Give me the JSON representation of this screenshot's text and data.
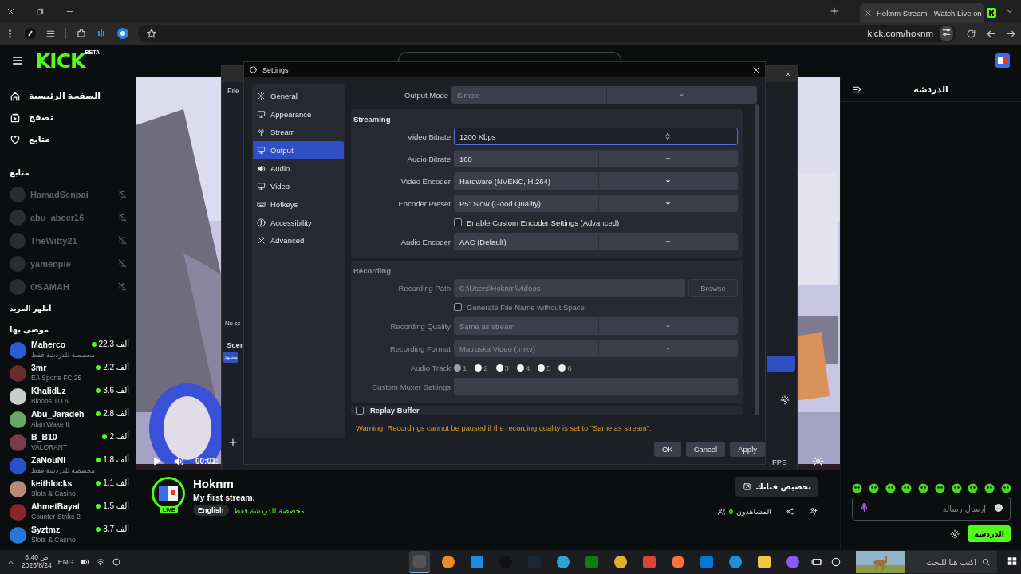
{
  "browser": {
    "tab_title": "Hoknm Stream - Watch Live on",
    "url": "kick.com/hoknm"
  },
  "header": {
    "logo": "KICK",
    "logo_badge": "BETA"
  },
  "sidebar": {
    "nav": [
      {
        "label": "الصفحة الرئيسية"
      },
      {
        "label": "تصفح"
      },
      {
        "label": "متابع"
      }
    ],
    "following_title": "متابع",
    "following": [
      {
        "name": "HamadSenpai",
        "live": false
      },
      {
        "name": "abu_abeer16",
        "live": false
      },
      {
        "name": "TheWitty21",
        "live": false
      },
      {
        "name": "yamenpie",
        "live": false
      },
      {
        "name": "OSAMAH",
        "live": false
      }
    ],
    "show_more": "أظهر المزيد",
    "recommended_title": "موصى بها",
    "recommended": [
      {
        "name": "Maherco",
        "category": "مخصصة للدردشة فقط",
        "viewers": "22.3 ألف",
        "live": true
      },
      {
        "name": "3mr",
        "category": "EA Sports FC 25",
        "viewers": "2.2 ألف",
        "live": true
      },
      {
        "name": "KhalidLz",
        "category": "Bloons TD 6",
        "viewers": "3.6 ألف",
        "live": true
      },
      {
        "name": "Abu_Jaradeh",
        "category": "Alan Wake II",
        "viewers": "2.8 ألف",
        "live": true
      },
      {
        "name": "B_B10",
        "category": "VALORANT",
        "viewers": "2 ألف",
        "live": true
      },
      {
        "name": "ZaNouNi",
        "category": "مخصصة للدردشة فقط",
        "viewers": "1.8 ألف",
        "live": true
      },
      {
        "name": "keithlocks",
        "category": "Slots & Casino",
        "viewers": "1.1 ألف",
        "live": true
      },
      {
        "name": "AhmetBayat",
        "category": "Counter-Strike 2",
        "viewers": "1.5 ألف",
        "live": true
      },
      {
        "name": "Syztmz",
        "category": "Slots & Casino",
        "viewers": "3.7 ألف",
        "live": true
      }
    ]
  },
  "player": {
    "time": "00:01:"
  },
  "stream": {
    "name": "Hoknm",
    "live_badge": "LIVE",
    "title": "My first stream.",
    "category": "مخصصة للدردشة فقط",
    "tag": "English",
    "customize_button": "تخصيص قناتك",
    "viewers_label": "المشاهدون",
    "viewers_count": "0"
  },
  "chat": {
    "title": "الدردشة",
    "placeholder": "إرسال رسالة",
    "send_button": "الدردشة"
  },
  "obs_main": {
    "menu": "File",
    "sources_empty": "No sc",
    "scenes_title": "Scen",
    "scene_item": "مشهد",
    "fps": "FPS"
  },
  "settings": {
    "title": "Settings",
    "nav": [
      {
        "label": "General",
        "selected": false
      },
      {
        "label": "Appearance",
        "selected": false
      },
      {
        "label": "Stream",
        "selected": false
      },
      {
        "label": "Output",
        "selected": true
      },
      {
        "label": "Audio",
        "selected": false
      },
      {
        "label": "Video",
        "selected": false
      },
      {
        "label": "Hotkeys",
        "selected": false
      },
      {
        "label": "Accessibility",
        "selected": false
      },
      {
        "label": "Advanced",
        "selected": false
      }
    ],
    "output_mode": {
      "label": "Output Mode",
      "value": "Simple",
      "disabled": true
    },
    "sections": [
      {
        "title": "Streaming",
        "disabled": false,
        "rows": [
          {
            "kind": "spin",
            "label": "Video Bitrate",
            "value": "1200 Kbps",
            "focused": true
          },
          {
            "kind": "select",
            "label": "Audio Bitrate",
            "value": "160"
          },
          {
            "kind": "select",
            "label": "Video Encoder",
            "value": "Hardware (NVENC, H.264)"
          },
          {
            "kind": "select",
            "label": "Encoder Preset",
            "value": "P5: Slow (Good Quality)"
          },
          {
            "kind": "checkbox",
            "label": "Enable Custom Encoder Settings (Advanced)",
            "checked": false
          },
          {
            "kind": "select",
            "label": "Audio Encoder",
            "value": "AAC (Default)"
          }
        ]
      },
      {
        "title": "Recording",
        "disabled": true,
        "rows": [
          {
            "kind": "path",
            "label": "Recording Path",
            "value": "C:\\Users\\Hoknm\\Videos",
            "button": "Browse"
          },
          {
            "kind": "checkbox",
            "label": "Generate File Name without Space",
            "checked": false
          },
          {
            "kind": "select",
            "label": "Recording Quality",
            "value": "Same as stream"
          },
          {
            "kind": "select",
            "label": "Recording Format",
            "value": "Matroska Video (.mkv)"
          },
          {
            "kind": "tracks",
            "label": "Audio Track",
            "tracks": [
              {
                "label": "1",
                "checked": true
              },
              {
                "label": "2",
                "checked": false
              },
              {
                "label": "3",
                "checked": false
              },
              {
                "label": "4",
                "checked": false
              },
              {
                "label": "5",
                "checked": false
              },
              {
                "label": "6",
                "checked": false
              }
            ]
          },
          {
            "kind": "text",
            "label": "Custom Muxer Settings"
          }
        ]
      }
    ],
    "replay_buffer": {
      "label": "Replay Buffer",
      "checked": false
    },
    "warning": "Warning: Recordings cannot be paused if the recording quality is set to \"Same as stream\".",
    "buttons": [
      "OK",
      "Cancel",
      "Apply"
    ]
  },
  "taskbar": {
    "time": "8:40",
    "period": "ص",
    "date": "2025/8/24",
    "language": "ENG",
    "search_placeholder": "اكتب هنا للبحث",
    "apps": [
      {
        "selected": true
      },
      {
        "selected": false
      },
      {
        "selected": false
      },
      {
        "selected": false
      },
      {
        "selected": false
      },
      {
        "selected": false
      },
      {
        "selected": false
      },
      {
        "selected": false
      },
      {
        "selected": false
      },
      {
        "selected": false
      },
      {
        "selected": false
      },
      {
        "selected": false
      },
      {
        "selected": false
      },
      {
        "selected": false
      }
    ]
  }
}
